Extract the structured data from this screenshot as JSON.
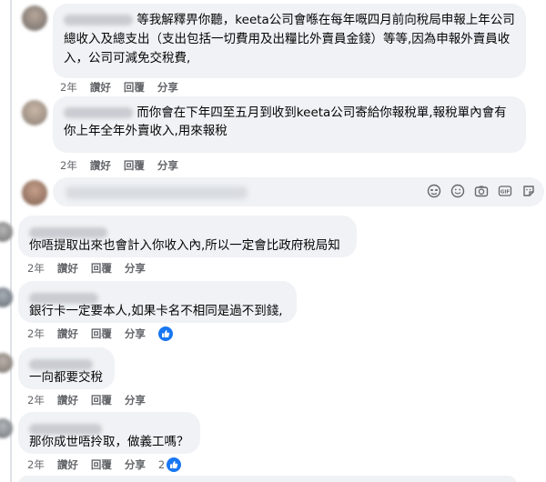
{
  "comments": [
    {
      "text_line1": "等我解釋畀你聽，keeta公司會喺在每年嘅四月前向稅局申報上年公司",
      "text_line2": "總收入及總支出（支出包括一切費用及出糧比外賣員金錢）等等,因為申報外賣員收",
      "text_line3": "入，公司可減免交稅費,",
      "time": "2年",
      "like": "讚好",
      "reply": "回覆",
      "share": "分享"
    },
    {
      "text_line1": "而你會在下年四至五月到收到keeta公司寄給你報稅單,報稅單內會有",
      "text_line2": "你上年全年外賣收入,用來報稅",
      "time": "2年",
      "like": "讚好",
      "reply": "回覆",
      "share": "分享"
    },
    {
      "text": "你唔提取出來也會計入你收入內,所以一定會比政府稅局知",
      "time": "2年",
      "like": "讚好",
      "reply": "回覆",
      "share": "分享"
    },
    {
      "text": "銀行卡一定要本人,如果卡名不相同是過不到錢,",
      "time": "2年",
      "like": "讚好",
      "reply": "回覆",
      "share": "分享"
    },
    {
      "text": "一向都要交稅",
      "time": "2年",
      "like": "讚好",
      "reply": "回覆",
      "share": "分享"
    },
    {
      "text": "那你成世唔拎取，做義工嗎？",
      "time": "2年",
      "like": "讚好",
      "reply": "回覆",
      "share": "分享",
      "reaction_count": "2"
    }
  ],
  "reply_input": {
    "icons": [
      "sticker-icon",
      "emoji-icon",
      "camera-icon",
      "gif-icon",
      "avatar-sticker-icon"
    ]
  },
  "colors": {
    "bubble": "#f0f2f5",
    "meta": "#65676b",
    "like_blue": "#1877f2"
  }
}
